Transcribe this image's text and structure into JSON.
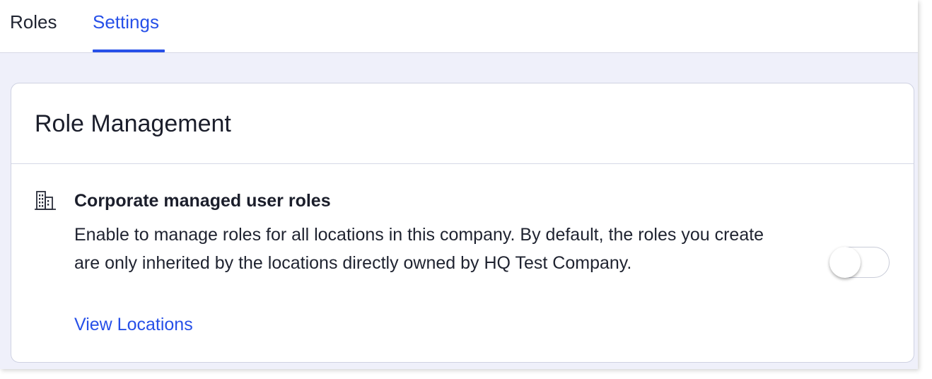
{
  "tabs": [
    {
      "label": "Roles",
      "active": false
    },
    {
      "label": "Settings",
      "active": true
    }
  ],
  "accent_color": "#2750e8",
  "card": {
    "title": "Role Management",
    "setting": {
      "icon": "building-icon",
      "title": "Corporate managed user roles",
      "description": "Enable to manage roles for all locations in this company. By default, the roles you create are only inherited by the locations directly owned by HQ Test Company.",
      "link_label": "View Locations",
      "toggle_on": false
    }
  }
}
